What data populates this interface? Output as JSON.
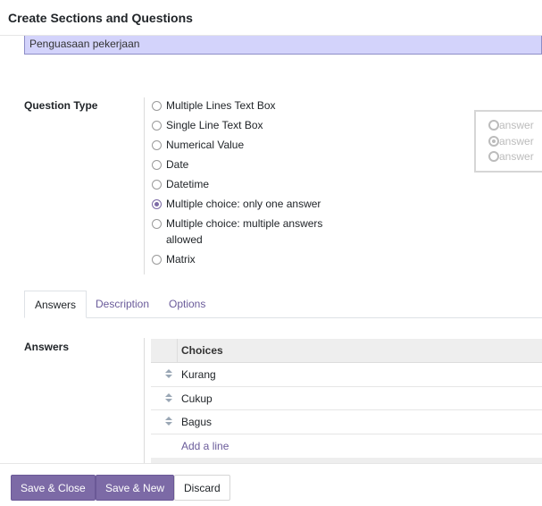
{
  "dialog": {
    "title": "Create Sections and Questions"
  },
  "title_field": {
    "value": "Penguasaan pekerjaan"
  },
  "question_type": {
    "label": "Question Type",
    "options": [
      {
        "label": "Multiple Lines Text Box",
        "checked": false
      },
      {
        "label": "Single Line Text Box",
        "checked": false
      },
      {
        "label": "Numerical Value",
        "checked": false
      },
      {
        "label": "Date",
        "checked": false
      },
      {
        "label": "Datetime",
        "checked": false
      },
      {
        "label": "Multiple choice: only one answer",
        "checked": true
      },
      {
        "label": "Multiple choice: multiple answers",
        "label_line2": "allowed",
        "checked": false
      },
      {
        "label": "Matrix",
        "checked": false
      }
    ]
  },
  "preview": {
    "items": [
      "answer",
      "answer",
      "answer"
    ],
    "checked_index": 1
  },
  "tabs": [
    {
      "label": "Answers",
      "active": true
    },
    {
      "label": "Description",
      "active": false
    },
    {
      "label": "Options",
      "active": false
    }
  ],
  "answers": {
    "label": "Answers",
    "column_header": "Choices",
    "rows": [
      "Kurang",
      "Cukup",
      "Bagus"
    ],
    "add_line": "Add a line"
  },
  "footer": {
    "save_close": "Save & Close",
    "save_new": "Save & New",
    "discard": "Discard"
  },
  "colors": {
    "primary": "#7c6aa6",
    "title_field_bg": "#d3d3fb",
    "link": "#6a5b9a"
  }
}
